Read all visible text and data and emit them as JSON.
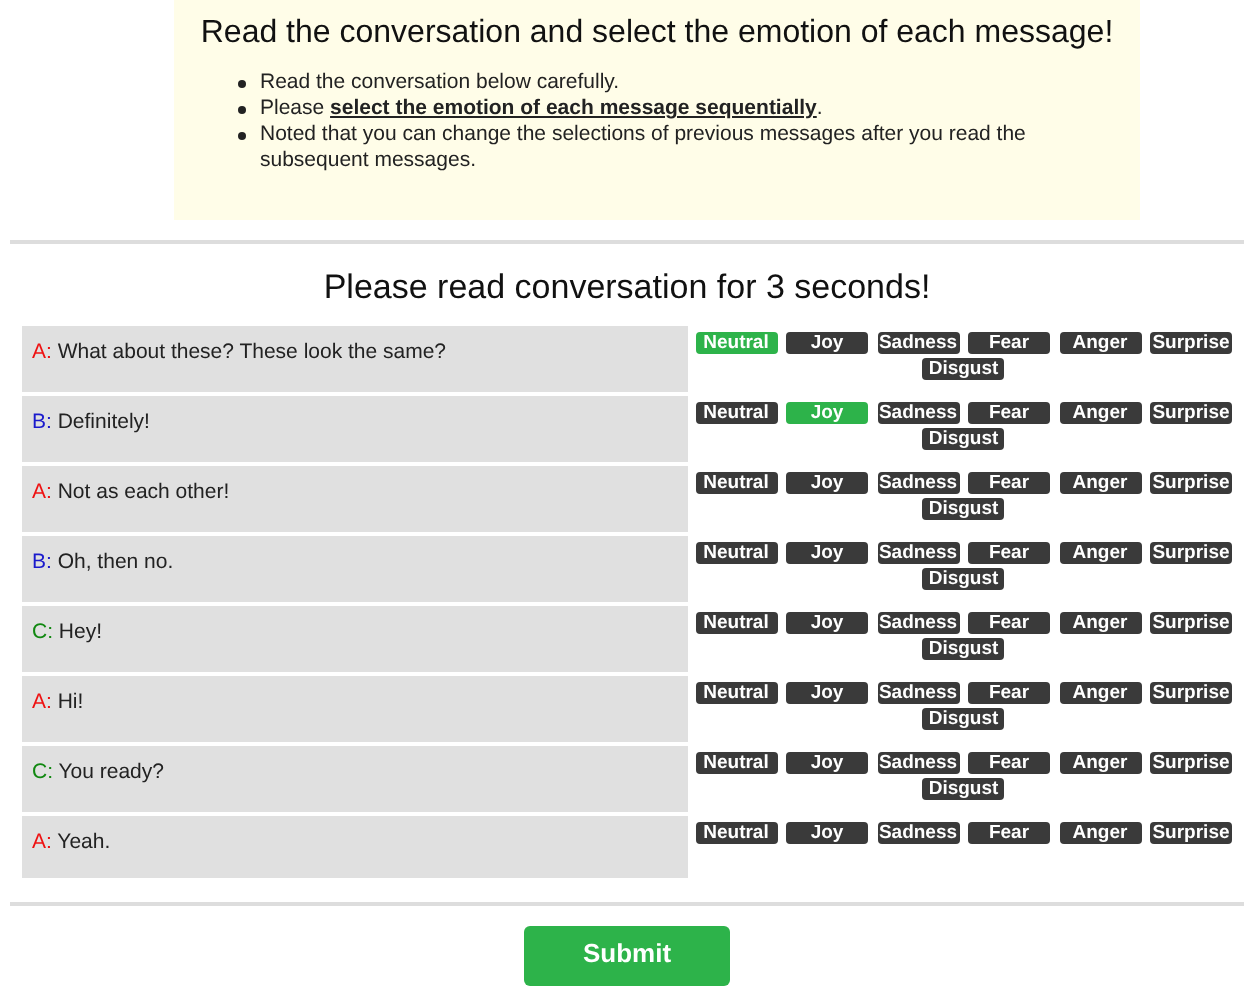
{
  "instructions": {
    "title": "Read the conversation and select the emotion of each message!",
    "items": [
      "Read the conversation below carefully.",
      "Please **select the emotion of each message sequentially**.",
      "Noted that you can change the selections of previous messages after you read the subsequent messages."
    ]
  },
  "prompt": "Please read conversation for 3 seconds!",
  "messages": [
    {
      "speaker": "A:",
      "color": "#ee1111",
      "text": "What about these? These look the same?",
      "emotions": [
        {
          "label": "Neutral",
          "selected": true
        },
        {
          "label": "Joy",
          "selected": false
        },
        {
          "label": "Sadness",
          "selected": false
        },
        {
          "label": "Fear",
          "selected": false
        },
        {
          "label": "Anger",
          "selected": false
        },
        {
          "label": "Surprise",
          "selected": false
        },
        {
          "label": "Disgust",
          "selected": false
        }
      ]
    },
    {
      "speaker": "B:",
      "color": "#1a1acc",
      "text": "Definitely!",
      "emotions": [
        {
          "label": "Neutral",
          "selected": false
        },
        {
          "label": "Joy",
          "selected": true
        },
        {
          "label": "Sadness",
          "selected": false
        },
        {
          "label": "Fear",
          "selected": false
        },
        {
          "label": "Anger",
          "selected": false
        },
        {
          "label": "Surprise",
          "selected": false
        },
        {
          "label": "Disgust",
          "selected": false
        }
      ]
    },
    {
      "speaker": "A:",
      "color": "#ee1111",
      "text": "Not as each other!",
      "emotions": [
        {
          "label": "Neutral",
          "selected": false
        },
        {
          "label": "Joy",
          "selected": false
        },
        {
          "label": "Sadness",
          "selected": false
        },
        {
          "label": "Fear",
          "selected": false
        },
        {
          "label": "Anger",
          "selected": false
        },
        {
          "label": "Surprise",
          "selected": false
        },
        {
          "label": "Disgust",
          "selected": false
        }
      ]
    },
    {
      "speaker": "B:",
      "color": "#1a1acc",
      "text": "Oh, then no.",
      "emotions": [
        {
          "label": "Neutral",
          "selected": false
        },
        {
          "label": "Joy",
          "selected": false
        },
        {
          "label": "Sadness",
          "selected": false
        },
        {
          "label": "Fear",
          "selected": false
        },
        {
          "label": "Anger",
          "selected": false
        },
        {
          "label": "Surprise",
          "selected": false
        },
        {
          "label": "Disgust",
          "selected": false
        }
      ]
    },
    {
      "speaker": "C:",
      "color": "#118811",
      "text": "Hey!",
      "emotions": [
        {
          "label": "Neutral",
          "selected": false
        },
        {
          "label": "Joy",
          "selected": false
        },
        {
          "label": "Sadness",
          "selected": false
        },
        {
          "label": "Fear",
          "selected": false
        },
        {
          "label": "Anger",
          "selected": false
        },
        {
          "label": "Surprise",
          "selected": false
        },
        {
          "label": "Disgust",
          "selected": false
        }
      ]
    },
    {
      "speaker": "A:",
      "color": "#ee1111",
      "text": "Hi!",
      "emotions": [
        {
          "label": "Neutral",
          "selected": false
        },
        {
          "label": "Joy",
          "selected": false
        },
        {
          "label": "Sadness",
          "selected": false
        },
        {
          "label": "Fear",
          "selected": false
        },
        {
          "label": "Anger",
          "selected": false
        },
        {
          "label": "Surprise",
          "selected": false
        },
        {
          "label": "Disgust",
          "selected": false
        }
      ]
    },
    {
      "speaker": "C:",
      "color": "#118811",
      "text": "You ready?",
      "emotions": [
        {
          "label": "Neutral",
          "selected": false
        },
        {
          "label": "Joy",
          "selected": false
        },
        {
          "label": "Sadness",
          "selected": false
        },
        {
          "label": "Fear",
          "selected": false
        },
        {
          "label": "Anger",
          "selected": false
        },
        {
          "label": "Surprise",
          "selected": false
        },
        {
          "label": "Disgust",
          "selected": false
        }
      ]
    },
    {
      "speaker": "A:",
      "color": "#ee1111",
      "text": "Yeah.",
      "emotions": [
        {
          "label": "Neutral",
          "selected": false
        },
        {
          "label": "Joy",
          "selected": false
        },
        {
          "label": "Sadness",
          "selected": false
        },
        {
          "label": "Fear",
          "selected": false
        },
        {
          "label": "Anger",
          "selected": false
        },
        {
          "label": "Surprise",
          "selected": false
        }
      ]
    }
  ],
  "submit": "Submit"
}
